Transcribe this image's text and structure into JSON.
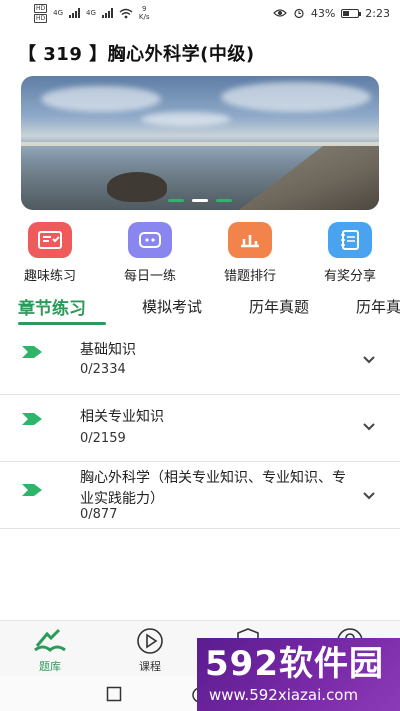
{
  "status_bar": {
    "sim_badges": [
      "HD",
      "HD"
    ],
    "network_1": "4G",
    "network_2": "4G",
    "speed_value": "9",
    "speed_unit": "K/s",
    "battery_percent": "43%",
    "battery_level": 0.43,
    "time": "2:23"
  },
  "header": {
    "title": "【 319 】胸心外科学(中级)"
  },
  "banner": {
    "slide_count": 3,
    "active_slide": 1
  },
  "quick_actions": [
    {
      "label": "趣味练习",
      "icon": "quiz-board-icon",
      "color": "#ef5a5a"
    },
    {
      "label": "每日一练",
      "icon": "daily-practice-icon",
      "color": "#8a86ef"
    },
    {
      "label": "错题排行",
      "icon": "wrong-ranking-icon",
      "color": "#f2834a"
    },
    {
      "label": "有奖分享",
      "icon": "share-notebook-icon",
      "color": "#4aa3f0"
    }
  ],
  "tabs": [
    {
      "label": "章节练习",
      "active": true
    },
    {
      "label": "模拟考试",
      "active": false
    },
    {
      "label": "历年真题",
      "active": false
    },
    {
      "label": "历年真",
      "active": false
    }
  ],
  "chapters": [
    {
      "title": "基础知识",
      "count": "0/2334"
    },
    {
      "title": "相关专业知识",
      "count": "0/2159"
    },
    {
      "title": "胸心外科学（相关专业知识、专业知识、专业实践能力）",
      "count": "0/877"
    }
  ],
  "bottom_nav": [
    {
      "label": "题库",
      "icon": "question-bank-icon",
      "active": true
    },
    {
      "label": "课程",
      "icon": "play-course-icon",
      "active": false
    },
    {
      "label": "",
      "icon": "shield-icon",
      "active": false
    },
    {
      "label": "",
      "icon": "user-icon",
      "active": false
    }
  ],
  "watermark": {
    "brand": "592软件园",
    "url": "www.592xiazai.com"
  },
  "colors": {
    "accent": "#2d9a5b",
    "flag": "#2db56a"
  }
}
